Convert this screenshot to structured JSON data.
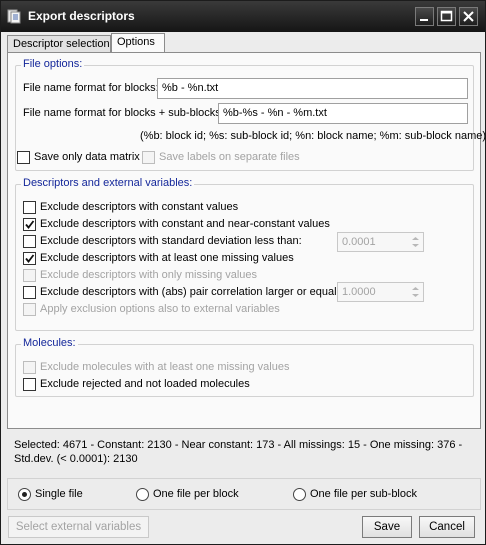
{
  "window": {
    "title": "Export descriptors"
  },
  "tabs": [
    {
      "label": "Descriptor selection",
      "active": false
    },
    {
      "label": "Options",
      "active": true
    }
  ],
  "file_options": {
    "group_label": "File options:",
    "blocks_label": "File name format for blocks:",
    "blocks_value": "%b - %n.txt",
    "subblocks_label": "File name format for blocks + sub-blocks:",
    "subblocks_value": "%b-%s - %n - %m.txt",
    "legend": "(%b: block id; %s: sub-block id; %n: block name; %m: sub-block name)",
    "save_only_matrix": {
      "label": "Save only data matrix",
      "checked": false
    },
    "save_labels": {
      "label": "Save labels on separate files",
      "checked": false,
      "enabled": false
    }
  },
  "descriptors": {
    "group_label": "Descriptors and external variables:",
    "options": [
      {
        "label": "Exclude descriptors with constant values",
        "checked": false,
        "enabled": true
      },
      {
        "label": "Exclude descriptors with constant and near-constant values",
        "checked": true,
        "enabled": true
      },
      {
        "label": "Exclude descriptors with standard deviation less than:",
        "checked": false,
        "enabled": true
      },
      {
        "label": "Exclude descriptors with at least one missing values",
        "checked": true,
        "enabled": true
      },
      {
        "label": "Exclude descriptors with only missing values",
        "checked": false,
        "enabled": false
      },
      {
        "label": "Exclude descriptors with (abs) pair correlation larger or equal to:",
        "checked": false,
        "enabled": true
      },
      {
        "label": "Apply exclusion options also to external variables",
        "checked": false,
        "enabled": false
      }
    ],
    "std_dev_value": "0.0001",
    "correlation_value": "1.0000"
  },
  "molecules": {
    "group_label": "Molecules:",
    "options": [
      {
        "label": "Exclude molecules with at least one missing values",
        "checked": false,
        "enabled": false
      },
      {
        "label": "Exclude rejected and not loaded molecules",
        "checked": false,
        "enabled": true
      }
    ]
  },
  "status": {
    "line1": "Selected: 4671 - Constant: 2130 - Near constant: 173 - All missings: 15 - One missing: 376 -",
    "line2": "Std.dev. (< 0.0001): 2130"
  },
  "output_mode": {
    "options": [
      {
        "label": "Single file",
        "selected": true
      },
      {
        "label": "One file per block",
        "selected": false
      },
      {
        "label": "One file per sub-block",
        "selected": false
      }
    ]
  },
  "buttons": {
    "select_external": "Select external variables",
    "save": "Save",
    "cancel": "Cancel"
  },
  "colors": {
    "group_label": "#14279a",
    "titlebar": "#1e1e1e",
    "disabled_text": "#a3a3a3"
  }
}
